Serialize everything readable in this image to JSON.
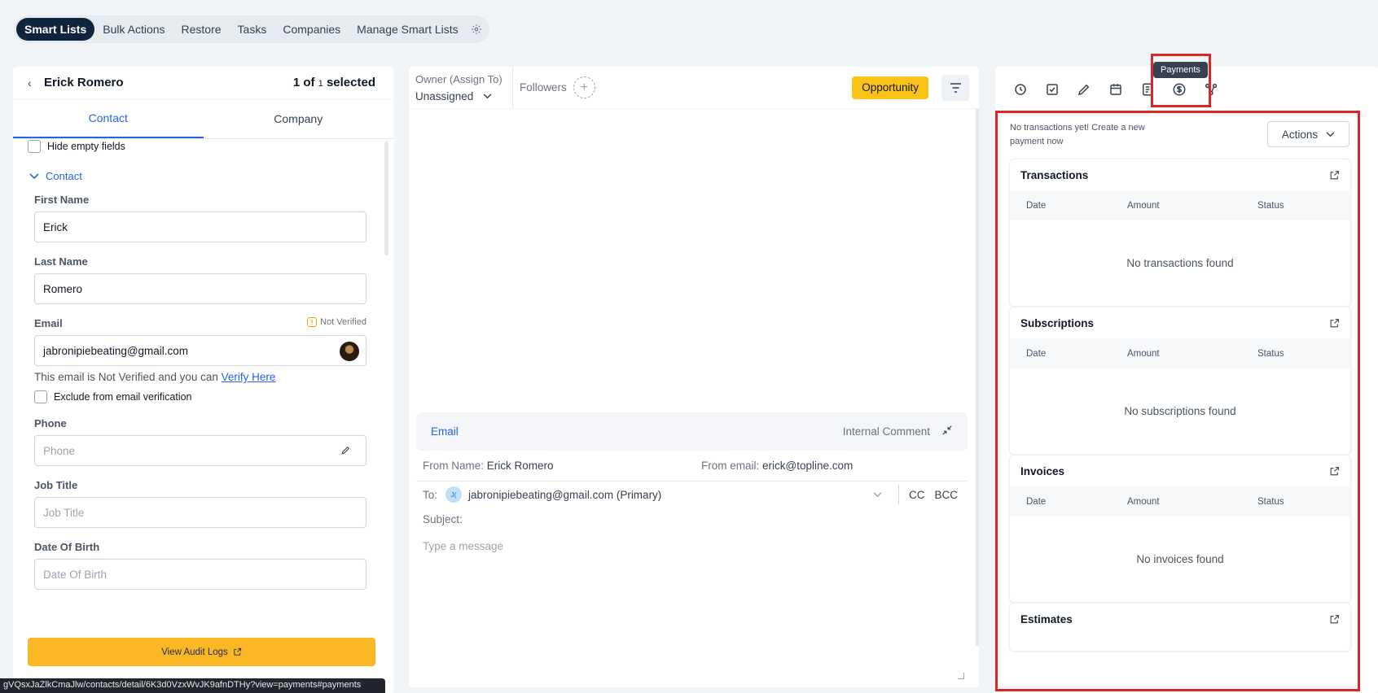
{
  "topnav": {
    "tabs": [
      "Smart Lists",
      "Bulk Actions",
      "Restore",
      "Tasks",
      "Companies",
      "Manage Smart Lists"
    ],
    "active": "Smart Lists"
  },
  "contact_panel": {
    "name": "Erick Romero",
    "selected_count": "1 of ",
    "selected_total": "1",
    "selected_suffix": " selected",
    "tabs": [
      "Contact",
      "Company"
    ],
    "hide_empty_label": "Hide empty fields",
    "section_label": "Contact",
    "first_name_label": "First Name",
    "first_name_value": "Erick",
    "last_name_label": "Last Name",
    "last_name_value": "Romero",
    "email_label": "Email",
    "not_verified_label": "Not Verified",
    "email_value": "jabronipiebeating@gmail.com",
    "email_hint_prefix": "This email is Not Verified and you can ",
    "verify_link": "Verify Here",
    "exclude_label": "Exclude from email verification",
    "phone_label": "Phone",
    "phone_placeholder": "Phone",
    "job_title_label": "Job Title",
    "job_title_placeholder": "Job Title",
    "dob_label": "Date Of Birth",
    "dob_placeholder": "Date Of Birth",
    "audit_button": "View Audit Logs"
  },
  "status_url": "gVQsxJaZlkCmaJlw/contacts/detail/6K3d0VzxWvJK9afnDTHy?view=payments#payments",
  "conversation": {
    "owner_label": "Owner (Assign To)",
    "owner_value": "Unassigned",
    "followers_label": "Followers",
    "opportunity_button": "Opportunity",
    "channel_email": "Email",
    "internal_comment": "Internal Comment",
    "from_name_label": "From Name:",
    "from_name_value": "Erick Romero",
    "from_email_label": "From email:",
    "from_email_value": "erick@topline.com",
    "to_label": "To:",
    "to_initials": "J(",
    "to_value": "jabronipiebeating@gmail.com (Primary)",
    "cc": "CC",
    "bcc": "BCC",
    "subject_label": "Subject:",
    "message_placeholder": "Type a message"
  },
  "payments": {
    "tooltip": "Payments",
    "empty_notice": "No transactions yet! Create a new payment now",
    "actions_label": "Actions",
    "columns": [
      "Date",
      "Amount",
      "Status"
    ],
    "sections": [
      {
        "title": "Transactions",
        "empty": "No transactions found"
      },
      {
        "title": "Subscriptions",
        "empty": "No subscriptions found"
      },
      {
        "title": "Invoices",
        "empty": "No invoices found"
      },
      {
        "title": "Estimates",
        "empty": ""
      }
    ]
  },
  "colors": {
    "accent": "#2563eb",
    "highlight": "#dc2626",
    "primary_button": "#fbb824",
    "nav_active": "#10243e"
  }
}
